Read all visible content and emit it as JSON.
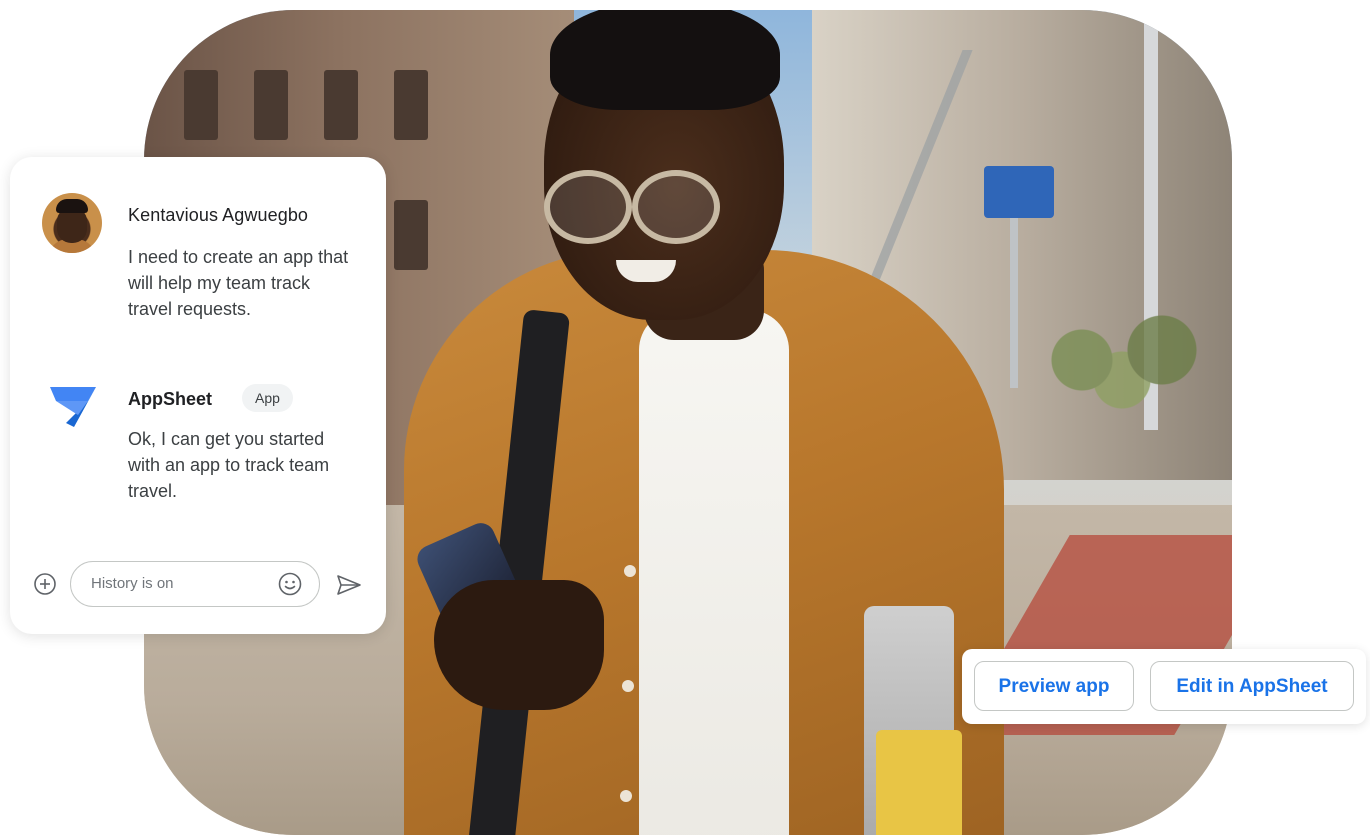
{
  "chat": {
    "user": {
      "name": "Kentavious Agwuegbo",
      "message": "I need to create an app that will help my team track travel requests."
    },
    "bot": {
      "name": "AppSheet",
      "badge": "App",
      "message": "Ok, I can get you started with an app to track team travel."
    },
    "input": {
      "placeholder": "History is on"
    },
    "icons": {
      "add": "add-circle-icon",
      "emoji": "emoji-icon",
      "send": "send-icon",
      "app_logo": "appsheet-logo-icon"
    }
  },
  "actions": {
    "preview_label": "Preview app",
    "edit_label": "Edit in AppSheet"
  },
  "colors": {
    "accent_blue": "#1a73e8",
    "logo_blue_light": "#4285f4",
    "logo_blue_dark": "#1967d2",
    "text_primary": "#202124",
    "text_secondary": "#3c4043"
  }
}
